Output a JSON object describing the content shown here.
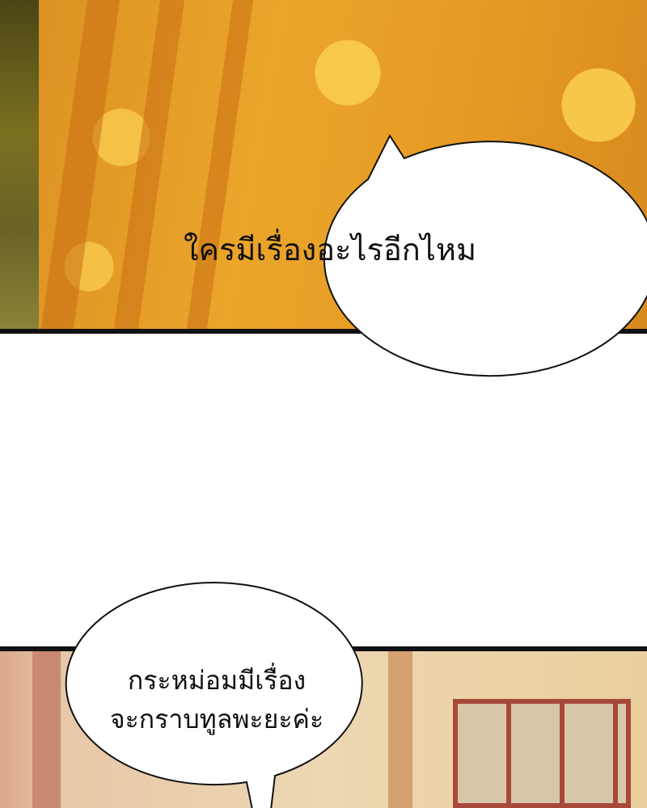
{
  "bubbles": {
    "top": {
      "text": "ใครมีเรื่องอะไรอีกไหม"
    },
    "bottom": {
      "line1": "กระหม่อมมีเรื่อง",
      "line2": "จะกราบทูลพะยะค่ะ"
    }
  },
  "colors": {
    "robe": "#eba52a",
    "border": "#111111",
    "palace": "#ecd7b2",
    "pillar": "#a8483a"
  }
}
